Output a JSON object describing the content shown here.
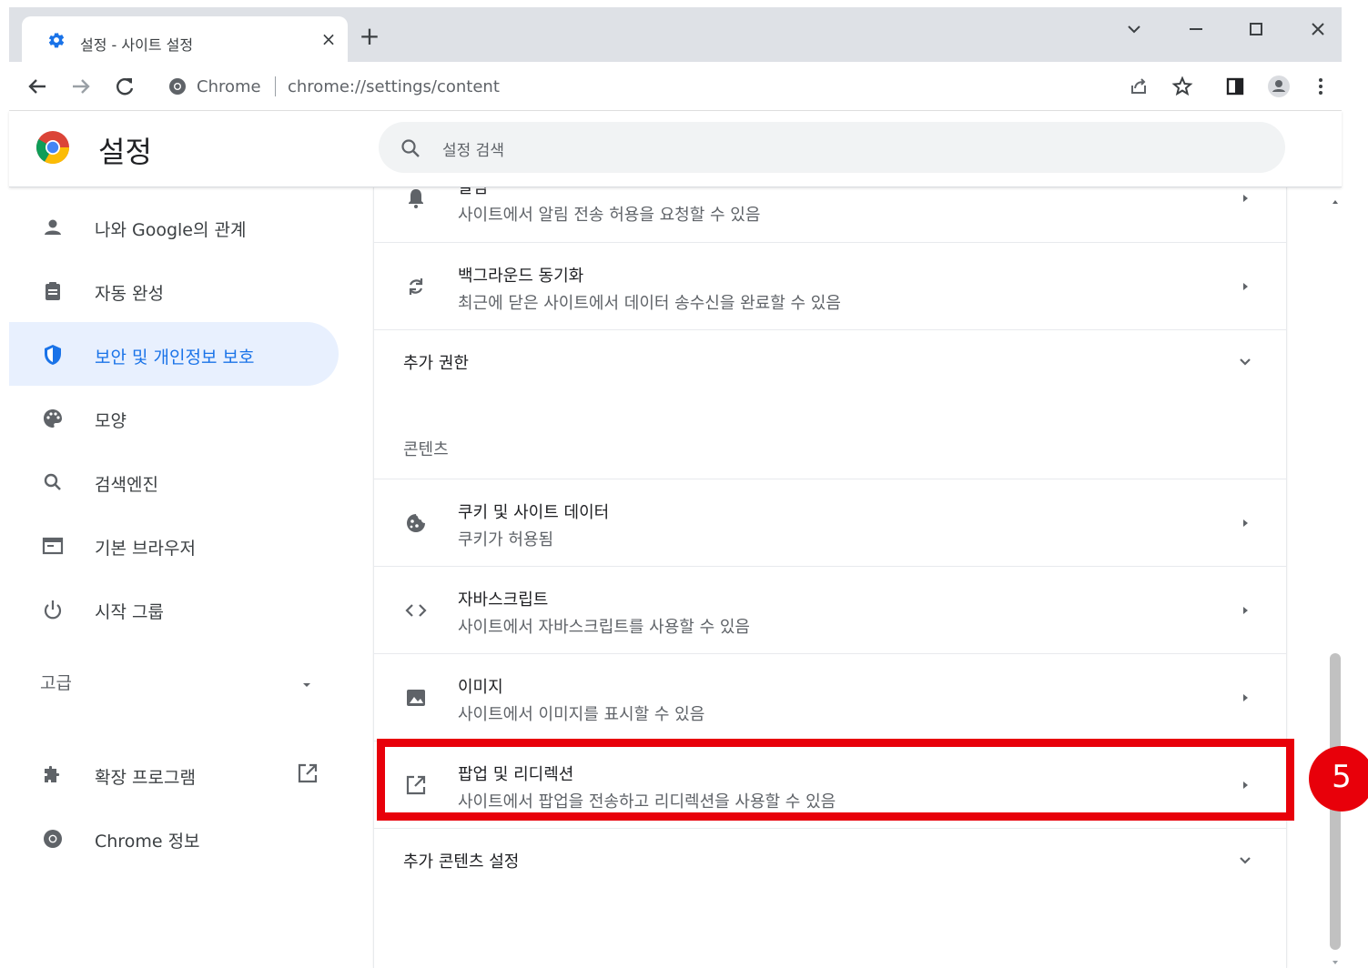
{
  "browser": {
    "tab_title": "설정 - 사이트 설정",
    "site_chip": "Chrome",
    "url_scheme": "chrome://",
    "url_path": "settings/content"
  },
  "header": {
    "title": "설정",
    "search_placeholder": "설정 검색"
  },
  "sidebar": {
    "items": [
      {
        "label": "나와 Google의 관계",
        "icon": "person-icon"
      },
      {
        "label": "자동 완성",
        "icon": "clipboard-icon"
      },
      {
        "label": "보안 및 개인정보 보호",
        "icon": "shield-icon",
        "active": true
      },
      {
        "label": "모양",
        "icon": "palette-icon"
      },
      {
        "label": "검색엔진",
        "icon": "search-icon"
      },
      {
        "label": "기본 브라우저",
        "icon": "browser-window-icon"
      },
      {
        "label": "시작 그룹",
        "icon": "power-icon"
      }
    ],
    "advanced_label": "고급",
    "extensions_label": "확장 프로그램",
    "about_label": "Chrome 정보"
  },
  "main": {
    "notification_row": {
      "title": "알림",
      "subtitle": "사이트에서 알림 전송 허용을 요청할 수 있음"
    },
    "background_sync": {
      "title": "백그라운드 동기화",
      "subtitle": "최근에 닫은 사이트에서 데이터 송수신을 완료할 수 있음"
    },
    "additional_permissions": "추가 권한",
    "content_section_title": "콘텐츠",
    "content_rows": [
      {
        "title": "쿠키 및 사이트 데이터",
        "subtitle": "쿠키가 허용됨",
        "icon": "cookie-icon"
      },
      {
        "title": "자바스크립트",
        "subtitle": "사이트에서 자바스크립트를 사용할 수 있음",
        "icon": "code-icon"
      },
      {
        "title": "이미지",
        "subtitle": "사이트에서 이미지를 표시할 수 있음",
        "icon": "image-icon"
      },
      {
        "title": "팝업 및 리디렉션",
        "subtitle": "사이트에서 팝업을 전송하고 리디렉션을 사용할 수 있음",
        "icon": "open-in-new-icon"
      }
    ],
    "additional_content_settings": "추가 콘텐츠 설정"
  },
  "annotation": {
    "step_number": "5",
    "color": "#e8000a"
  },
  "colors": {
    "accent": "#1a73e8",
    "active_bg": "#e8f0fe",
    "highlight": "#e8000a"
  }
}
